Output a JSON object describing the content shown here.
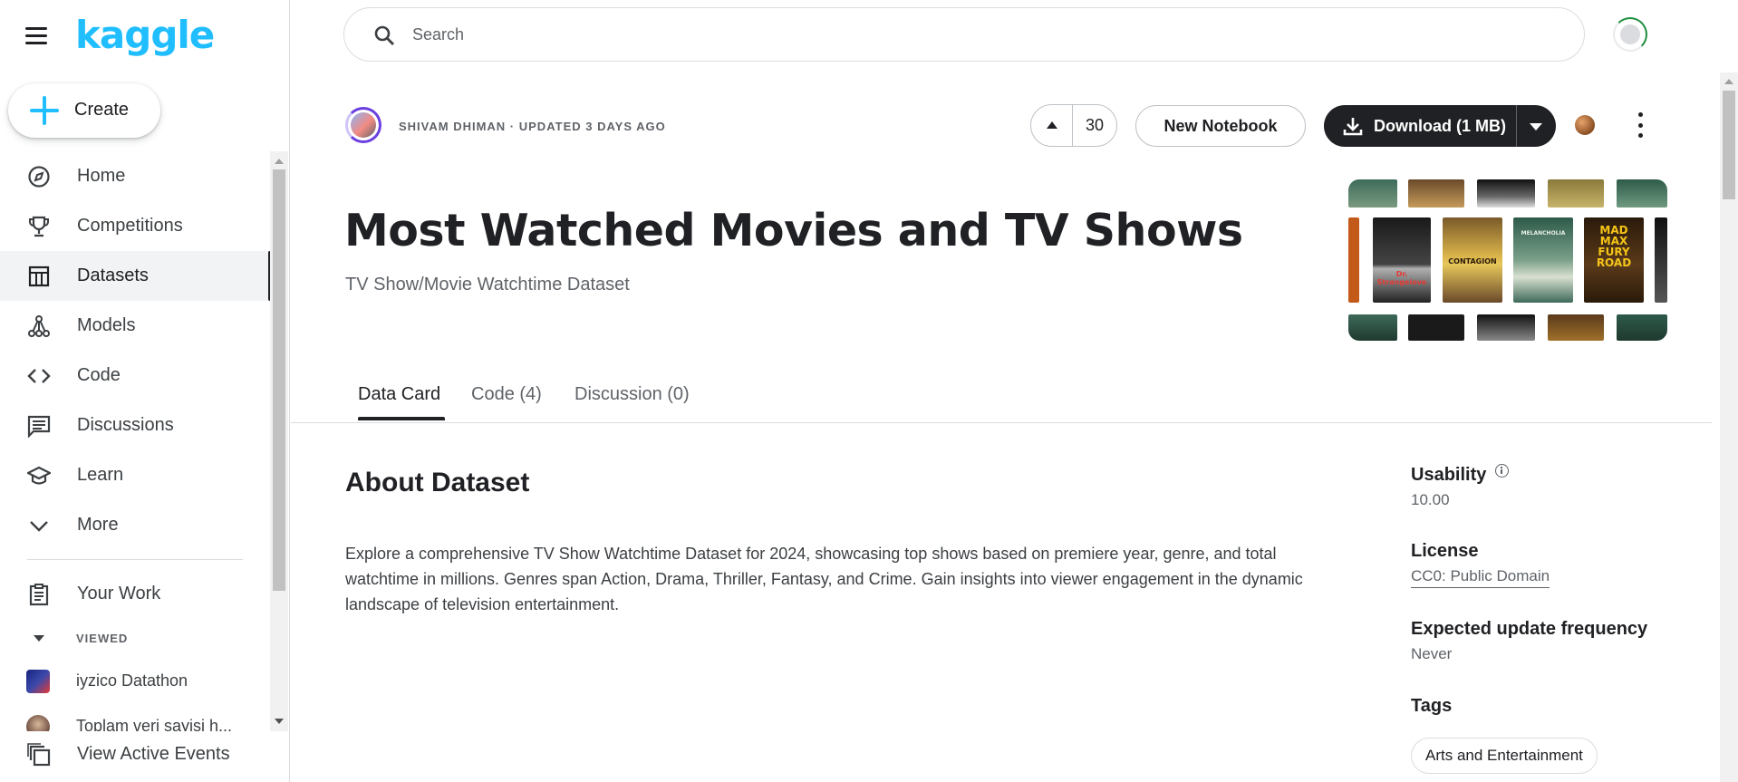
{
  "app": {
    "logo_text": "kaggle",
    "accent_color": "#20beff"
  },
  "sidebar": {
    "create_label": "Create",
    "items": [
      {
        "label": "Home",
        "icon": "compass-icon"
      },
      {
        "label": "Competitions",
        "icon": "trophy-icon"
      },
      {
        "label": "Datasets",
        "icon": "table-icon",
        "active": true
      },
      {
        "label": "Models",
        "icon": "models-icon"
      },
      {
        "label": "Code",
        "icon": "code-icon"
      },
      {
        "label": "Discussions",
        "icon": "discussion-icon"
      },
      {
        "label": "Learn",
        "icon": "learn-icon"
      },
      {
        "label": "More",
        "icon": "chevron-down-icon"
      }
    ],
    "your_work_label": "Your Work",
    "viewed_label": "VIEWED",
    "viewed_items": [
      {
        "label": "iyzico Datathon"
      },
      {
        "label": "Toplam veri sayisi h..."
      }
    ],
    "active_events_label": "View Active Events"
  },
  "search": {
    "placeholder": "Search"
  },
  "dataset": {
    "owner_meta": "SHIVAM DHIMAN · UPDATED 3 DAYS AGO",
    "upvotes": "30",
    "new_notebook_label": "New Notebook",
    "download_label": "Download (1 MB)",
    "title": "Most Watched Movies and TV Shows",
    "subtitle": "TV Show/Movie Watchtime Dataset",
    "cover_posters": [
      "Dr. Strangelove",
      "CONTAGION",
      "MELANCHOLIA",
      "MAD MAX FURY ROAD"
    ]
  },
  "tabs": [
    {
      "label": "Data Card",
      "active": true
    },
    {
      "label": "Code (4)"
    },
    {
      "label": "Discussion (0)"
    }
  ],
  "about": {
    "heading": "About Dataset",
    "body": "Explore a comprehensive TV Show Watchtime Dataset for 2024, showcasing top shows based on premiere year, genre, and total watchtime in millions. Genres span Action, Drama, Thriller, Fantasy, and Crime. Gain insights into viewer engagement in the dynamic landscape of television entertainment."
  },
  "metadata": {
    "usability_label": "Usability",
    "usability_value": "10.00",
    "license_label": "License",
    "license_value": "CC0: Public Domain",
    "frequency_label": "Expected update frequency",
    "frequency_value": "Never",
    "tags_label": "Tags",
    "tags": [
      "Arts and Entertainment"
    ]
  }
}
